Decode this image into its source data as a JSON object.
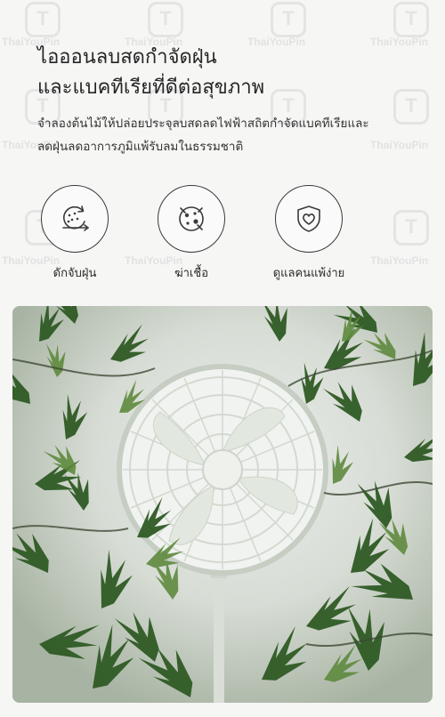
{
  "watermark": {
    "text": "ThaiYouPin",
    "logo_letter": "T"
  },
  "headline": {
    "line1": "ไอออนลบสดกำจัดฝุ่น",
    "line2": "และแบคทีเรียที่ดีต่อสุขภาพ"
  },
  "description": {
    "line1": "จำลองต้นไม้ให้ปล่อยประจุลบสดลดไฟฟ้าสถิตกำจัดแบคทีเรียและ",
    "line2": "ลดฝุ่นลดอาการภูมิแพ้รับลมในธรรมชาติ"
  },
  "features": [
    {
      "icon": "dust-capture-icon",
      "label": "ดักจับฝุ่น"
    },
    {
      "icon": "bacteria-kill-icon",
      "label": "ฆ่าเชื้อ"
    },
    {
      "icon": "heart-shield-icon",
      "label": "ดูแลคนแพ้ง่าย"
    }
  ],
  "colors": {
    "background": "#f6f6f5",
    "text": "#262626",
    "icon_stroke": "#3a3a3a",
    "leaf_dark": "#2f5a24",
    "leaf_light": "#5e8a3e"
  }
}
